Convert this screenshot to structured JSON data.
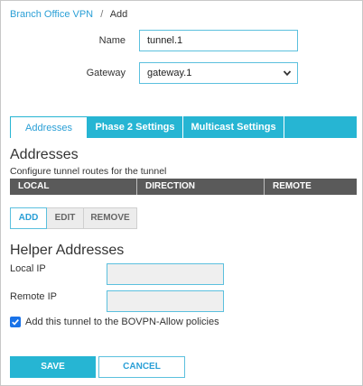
{
  "breadcrumb": {
    "parent": "Branch Office VPN",
    "separator": "/",
    "current": "Add"
  },
  "form": {
    "name_label": "Name",
    "name_value": "tunnel.1",
    "gateway_label": "Gateway",
    "gateway_value": "gateway.1"
  },
  "tabs": [
    {
      "label": "Addresses",
      "active": true
    },
    {
      "label": "Phase 2 Settings",
      "active": false
    },
    {
      "label": "Multicast Settings",
      "active": false
    }
  ],
  "addresses": {
    "title": "Addresses",
    "description": "Configure tunnel routes for the tunnel",
    "columns": [
      "LOCAL",
      "DIRECTION",
      "REMOTE"
    ],
    "buttons": {
      "add": "ADD",
      "edit": "EDIT",
      "remove": "REMOVE"
    }
  },
  "helper": {
    "title": "Helper Addresses",
    "local_ip_label": "Local IP",
    "local_ip_value": "",
    "remote_ip_label": "Remote IP",
    "remote_ip_value": ""
  },
  "policy_checkbox": {
    "label": "Add this tunnel to the BOVPN-Allow policies",
    "checked": true
  },
  "actions": {
    "save": "SAVE",
    "cancel": "CANCEL"
  },
  "colors": {
    "accent": "#26b5d3",
    "link": "#2a9fd6",
    "table_header": "#5a5a5a",
    "checkbox": "#1a73e8"
  }
}
